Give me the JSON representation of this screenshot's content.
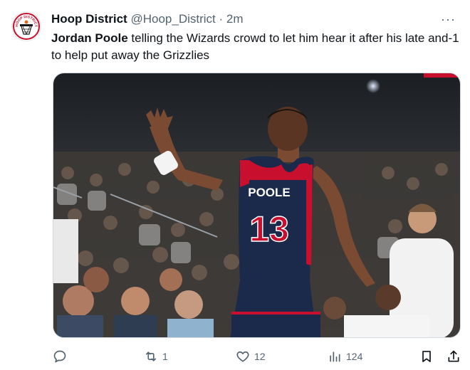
{
  "tweet": {
    "author_name": "Hoop District",
    "handle": "@Hoop_District",
    "separator": "·",
    "time": "2m",
    "more": "···",
    "text_bold": "Jordan Poole",
    "text_rest": " telling the Wizards crowd to let him hear it after his late and-1 to help put away the Grizzlies"
  },
  "avatar": {
    "logo_text": "HOOP DISTRICT",
    "icon": "basketball-hoop-logo"
  },
  "media": {
    "jersey_name": "POOLE",
    "jersey_number": "13",
    "colors": {
      "jersey_navy": "#1b2a4a",
      "jersey_red": "#c8102e"
    }
  },
  "actions": {
    "reply": {
      "icon": "reply-icon",
      "count": ""
    },
    "retweet": {
      "icon": "retweet-icon",
      "count": "1"
    },
    "like": {
      "icon": "heart-icon",
      "count": "12"
    },
    "views": {
      "icon": "views-icon",
      "count": "124"
    },
    "bookmark": {
      "icon": "bookmark-icon"
    },
    "share": {
      "icon": "share-icon"
    }
  },
  "colors": {
    "text": "#0f1419",
    "secondary": "#536471",
    "border": "#cfd9de"
  }
}
